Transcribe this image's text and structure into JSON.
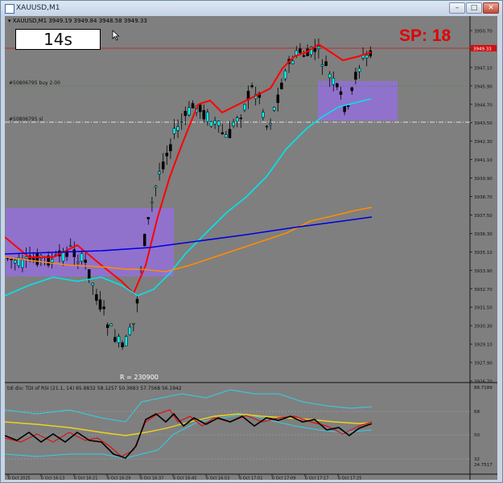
{
  "window": {
    "title": "XAUUSD,M1",
    "buttons": [
      "–",
      "□",
      "✕"
    ]
  },
  "chart_header": {
    "symbol_info": "▾ XAUUSD,M1  3949.19 3949.84 3948.58 3949.33"
  },
  "countdown": "14s",
  "spread_label": "SP: 18",
  "orders": {
    "buy_label": "#50806795 buy 2.00",
    "sl_label": "#50806795 sl"
  },
  "current_price_tag": "3949.33",
  "r_label": "R = 230900",
  "indicator_title": "tdi div: TDI of RSI  (21.1, 14) 65.8832 58.1257 50.3683 57.7568 56.1942",
  "price_axis": [
    "3950.70",
    "3948.76",
    "3947.10",
    "3945.90",
    "3944.70",
    "3943.50",
    "3942.30",
    "3941.10",
    "3939.90",
    "3938.70",
    "3937.50",
    "3936.30",
    "3935.10",
    "3933.90",
    "3932.70",
    "3931.50",
    "3930.30",
    "3929.10",
    "3927.90",
    "3926.70"
  ],
  "indicator_axis": [
    "88.7189",
    "68",
    "50",
    "32",
    "24.7517"
  ],
  "time_axis": [
    "6 Oct 2025",
    "6 Oct 16:13",
    "6 Oct 16:21",
    "6 Oct 16:29",
    "6 Oct 16:37",
    "6 Oct 16:45",
    "6 Oct 16:53",
    "6 Oct 17:01",
    "6 Oct 17:09",
    "6 Oct 17:17",
    "6 Oct 17:25"
  ],
  "colors": {
    "chart_bg": "#7f7f7f",
    "bull_candle": "#00ffff",
    "bear_candle": "#000000",
    "ema_fast": "#ff0000",
    "ema_mid": "#00e5ee",
    "ema_slow_orange": "#ff8c00",
    "ema_slow_blue": "#0000e0",
    "zone": "#9370db",
    "spread_text": "#e10000"
  }
}
